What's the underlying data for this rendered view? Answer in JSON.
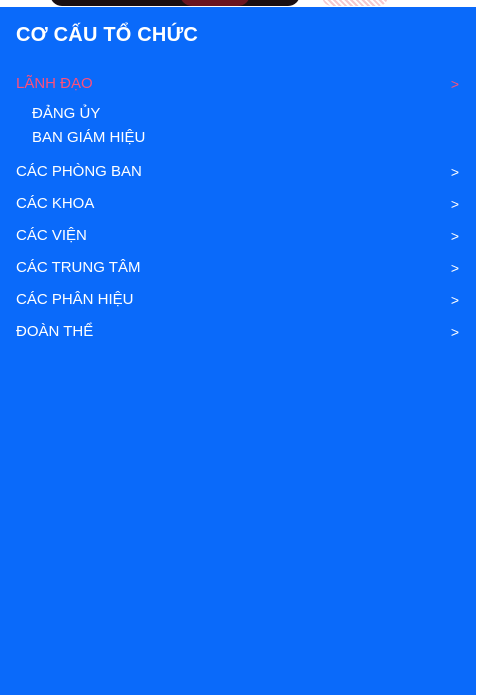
{
  "panel": {
    "title": "CƠ CẤU TỔ CHỨC",
    "background": "#0a6afa",
    "active_color": "#ff4f7a"
  },
  "menu": {
    "chevron": ">",
    "items": [
      {
        "label": "LÃNH ĐẠO",
        "active": true
      },
      {
        "label": "CÁC PHÒNG BAN"
      },
      {
        "label": "CÁC KHOA"
      },
      {
        "label": "CÁC VIỆN"
      },
      {
        "label": "CÁC TRUNG TÂM"
      },
      {
        "label": "CÁC PHÂN HIỆU"
      },
      {
        "label": "ĐOÀN THỂ"
      }
    ],
    "subitems": [
      {
        "label": "ĐẢNG ỦY"
      },
      {
        "label": "BAN GIÁM HIỆU"
      }
    ]
  }
}
